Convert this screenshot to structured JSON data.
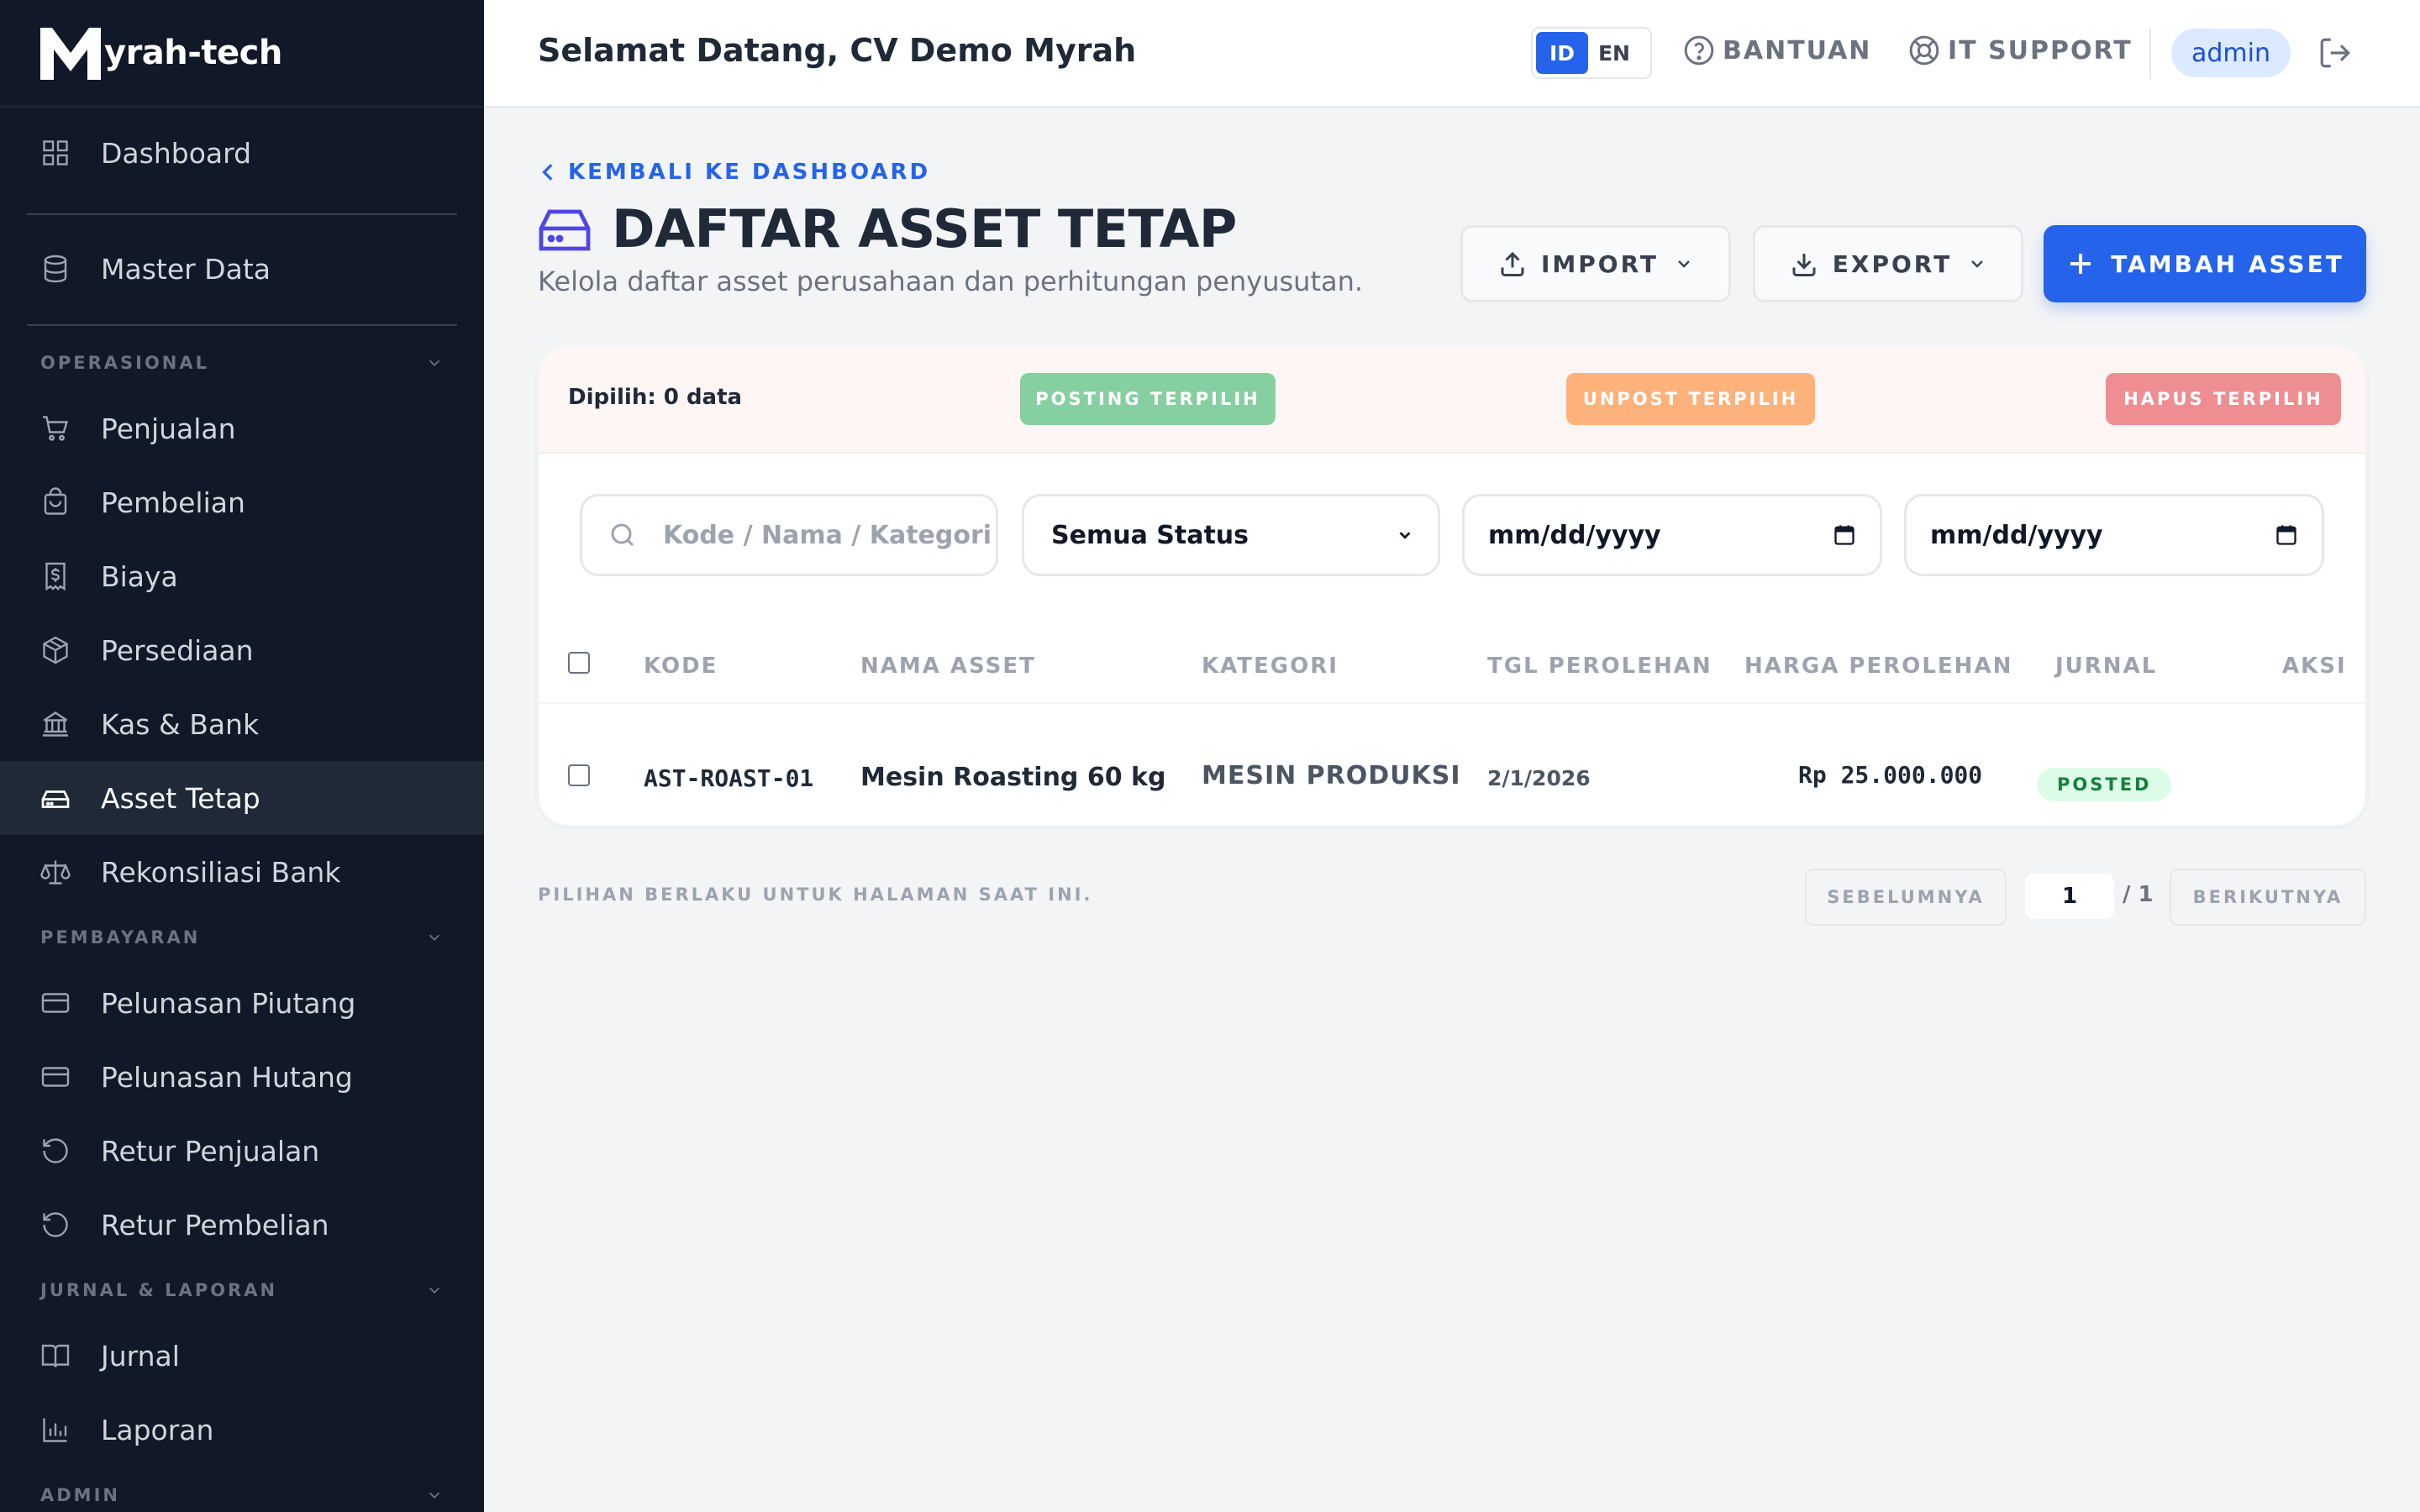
{
  "brand": {
    "text": "yrah-tech"
  },
  "sidebar": {
    "dashboard": "Dashboard",
    "master_data": "Master Data",
    "sections": {
      "operasional": "OPERASIONAL",
      "pembayaran": "PEMBAYARAN",
      "jurnal_laporan": "JURNAL & LAPORAN",
      "admin": "ADMIN"
    },
    "operasional_items": [
      "Penjualan",
      "Pembelian",
      "Biaya",
      "Persediaan",
      "Kas & Bank",
      "Asset Tetap",
      "Rekonsiliasi Bank"
    ],
    "pembayaran_items": [
      "Pelunasan Piutang",
      "Pelunasan Hutang",
      "Retur Penjualan",
      "Retur Pembelian"
    ],
    "jurnal_items": [
      "Jurnal",
      "Laporan"
    ],
    "active_item": "Asset Tetap"
  },
  "header": {
    "welcome": "Selamat Datang, CV Demo Myrah",
    "lang_id": "ID",
    "lang_en": "EN",
    "help": "BANTUAN",
    "support": "IT SUPPORT",
    "user": "admin"
  },
  "page": {
    "back": "KEMBALI KE DASHBOARD",
    "title": "DAFTAR ASSET TETAP",
    "subtitle": "Kelola daftar asset perusahaan dan perhitungan penyusutan.",
    "import": "IMPORT",
    "export": "EXPORT",
    "add": "TAMBAH ASSET"
  },
  "bulk": {
    "selected": "Dipilih: 0 data",
    "post": "POSTING TERPILIH",
    "unpost": "UNPOST TERPILIH",
    "delete": "HAPUS TERPILIH"
  },
  "filters": {
    "search_placeholder": "Kode / Nama / Kategori",
    "status": "Semua Status",
    "date_from": "mm/dd/yyyy",
    "date_to": "mm/dd/yyyy"
  },
  "table": {
    "columns": [
      "KODE",
      "NAMA ASSET",
      "KATEGORI",
      "TGL PEROLEHAN",
      "HARGA PEROLEHAN",
      "JURNAL",
      "AKSI"
    ],
    "rows": [
      {
        "code": "AST-ROAST-01",
        "name": "Mesin Roasting 60 kg",
        "category": "MESIN PRODUKSI",
        "date": "2/1/2026",
        "price": "Rp 25.000.000",
        "journal": "POSTED"
      }
    ]
  },
  "footer": {
    "note": "PILIHAN BERLAKU UNTUK HALAMAN SAAT INI.",
    "prev": "SEBELUMNYA",
    "page": "1",
    "total": "/ 1",
    "next": "BERIKUTNYA"
  },
  "colors": {
    "primary": "#2563eb",
    "sidebar_bg": "#111827",
    "posted_bg": "#dcfce7",
    "posted_fg": "#15803d"
  }
}
